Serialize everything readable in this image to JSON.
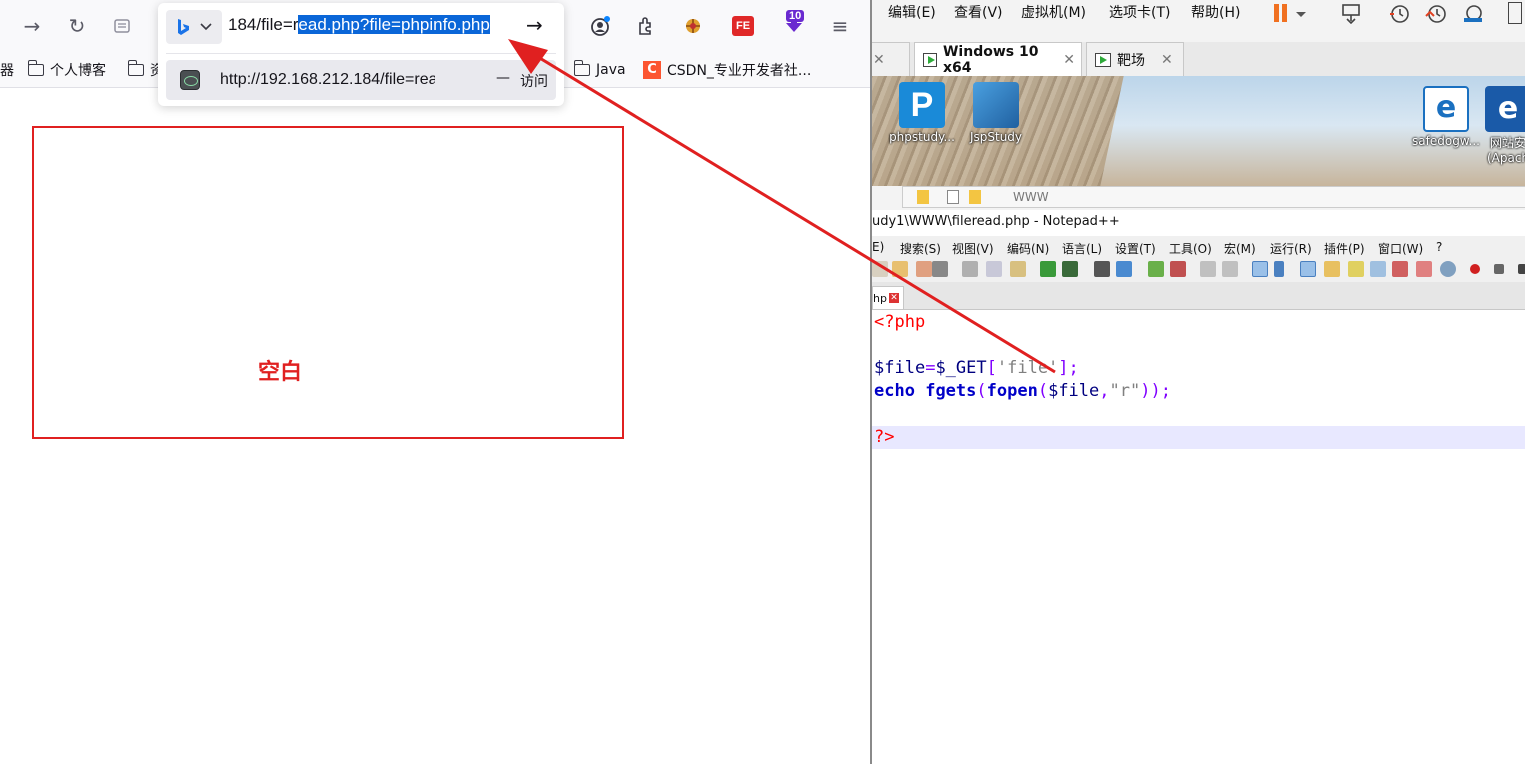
{
  "browser": {
    "url_prefix": "184/file=",
    "url_selected": "ead.php?file=phpinfo.php",
    "url_prefix_lead": "r",
    "suggestion_url": "http://192.168.212.184/file=read",
    "suggestion_sep": "—",
    "suggestion_action": "访问",
    "bookmarks": [
      "器",
      "个人博客",
      "资",
      "Java",
      "CSDN_专业开发者社..."
    ],
    "extension_badge": "10",
    "ext_fe_label": "FE",
    "blank_label": "空白"
  },
  "vmware": {
    "menus": [
      "编辑(E)",
      "查看(V)",
      "虚拟机(M)",
      "选项卡(T)",
      "帮助(H)"
    ],
    "tabs": [
      "Windows 10 x64",
      "靶场"
    ],
    "desktop_icons": [
      "phpstudy...",
      "JspStudy",
      "safedogw...",
      "网站安",
      "(Apach"
    ],
    "explorer_path": "WWW"
  },
  "notepad": {
    "title": "udy1\\WWW\\fileread.php - Notepad++",
    "menus": [
      "E)",
      "搜索(S)",
      "视图(V)",
      "编码(N)",
      "语言(L)",
      "设置(T)",
      "工具(O)",
      "宏(M)",
      "运行(R)",
      "插件(P)",
      "窗口(W)",
      "?"
    ],
    "tab_label": "hp",
    "code": {
      "open_tag": "<?php",
      "var_file": "$file",
      "eq": "=",
      "get": "$_GET",
      "br_open": "[",
      "str_file": "'file'",
      "br_close": "];",
      "kw_echo": "echo",
      "fn_fgets": "fgets",
      "p_open": "(",
      "fn_fopen": "fopen",
      "comma": ",",
      "str_r": "\"r\"",
      "p_close": "));",
      "close_tag": "?>"
    }
  },
  "colors": {
    "annotation_red": "#e02020",
    "selection_blue": "#0a66d8"
  }
}
